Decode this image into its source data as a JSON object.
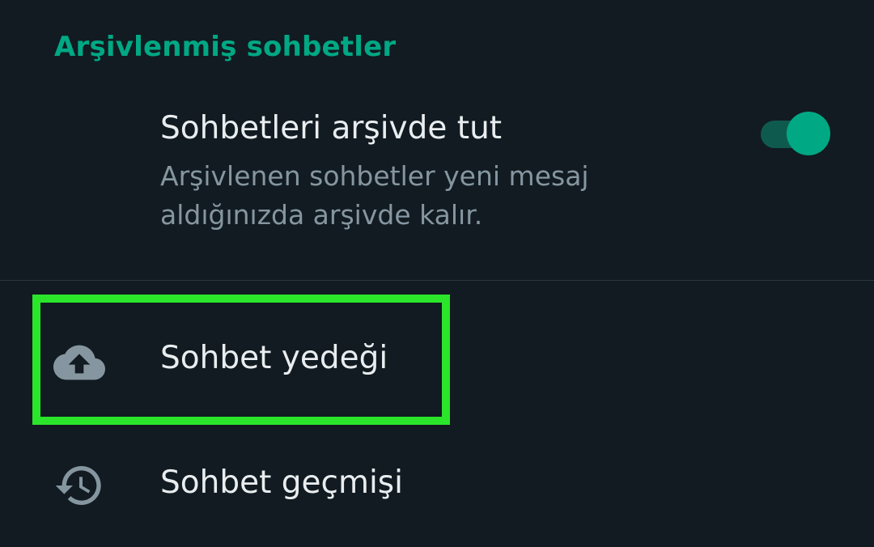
{
  "section": {
    "header": "Arşivlenmiş sohbetler"
  },
  "archive_setting": {
    "title": "Sohbetleri arşivde tut",
    "description": "Arşivlenen sohbetler yeni mesaj aldığınızda arşivde kalır.",
    "toggle_on": true
  },
  "menu": {
    "items": [
      {
        "label": "Sohbet yedeği",
        "icon": "cloud-upload-icon"
      },
      {
        "label": "Sohbet geçmişi",
        "icon": "history-icon"
      }
    ]
  },
  "highlight": {
    "target": "Sohbet yedeği",
    "color": "#2be52b"
  },
  "colors": {
    "background": "#111b21",
    "accent": "#00a884",
    "primary_text": "#e9edef",
    "secondary_text": "#8696a0"
  }
}
